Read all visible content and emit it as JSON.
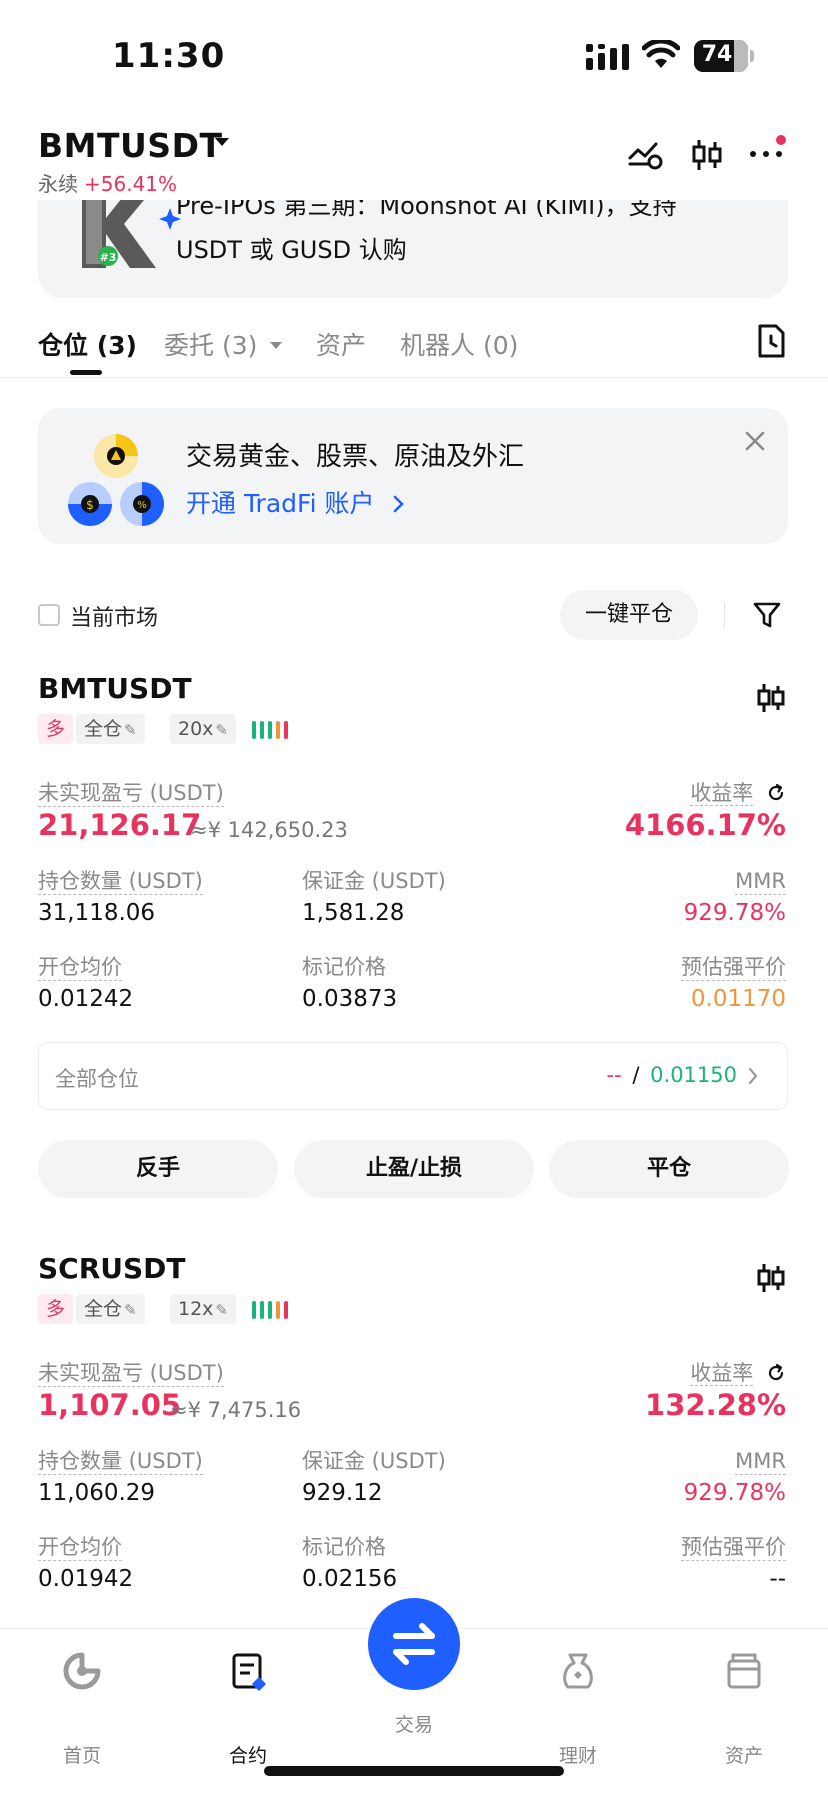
{
  "status_bar": {
    "time": "11:30",
    "battery": "74"
  },
  "header": {
    "symbol": "BMTUSDT",
    "type": "永续",
    "change": "+56.41%"
  },
  "promo": {
    "line1": "Pre-IPOs 第三期：Moonshot AI (KIMI)，支持",
    "line2": "USDT 或 GUSD 认购",
    "badge": "#3"
  },
  "tabs": [
    {
      "label": "仓位 (3)"
    },
    {
      "label": "委托 (3)"
    },
    {
      "label": "资产"
    },
    {
      "label": "机器人 (0)"
    }
  ],
  "tradfi": {
    "title": "交易黄金、股票、原油及外汇",
    "link": "开通 TradFi 账户"
  },
  "filter": {
    "current_market": "当前市场",
    "close_all": "一键平仓"
  },
  "labels": {
    "unrealized_pnl": "未实现盈亏 (USDT)",
    "roe": "收益率",
    "size": "持仓数量 (USDT)",
    "margin": "保证金 (USDT)",
    "mmr": "MMR",
    "entry_price": "开仓均价",
    "mark_price": "标记价格",
    "liq_price": "预估强平价",
    "all_positions": "全部仓位",
    "reverse": "反手",
    "tpsl": "止盈/止损",
    "close": "平仓"
  },
  "positions": [
    {
      "symbol": "BMTUSDT",
      "side": "多",
      "margin_mode": "全仓",
      "leverage": "20x",
      "unrealized_pnl": "21,126.17",
      "pnl_cny": "≈¥ 142,650.23",
      "roe": "4166.17%",
      "size": "31,118.06",
      "margin": "1,581.28",
      "mmr": "929.78%",
      "entry_price": "0.01242",
      "mark_price": "0.03873",
      "liq_price": "0.01170",
      "all_pos_tp": "--",
      "all_pos_sep": "/",
      "all_pos_sl": "0.01150"
    },
    {
      "symbol": "SCRUSDT",
      "side": "多",
      "margin_mode": "全仓",
      "leverage": "12x",
      "unrealized_pnl": "1,107.05",
      "pnl_cny": "≈¥ 7,475.16",
      "roe": "132.28%",
      "size": "11,060.29",
      "margin": "929.12",
      "mmr": "929.78%",
      "entry_price": "0.01942",
      "mark_price": "0.02156",
      "liq_price": "--"
    }
  ],
  "bottom_nav": [
    {
      "label": "首页",
      "icon": "home-icon"
    },
    {
      "label": "合约",
      "icon": "contract-icon"
    },
    {
      "label": "交易",
      "icon": "swap-icon"
    },
    {
      "label": "理财",
      "icon": "earn-icon"
    },
    {
      "label": "资产",
      "icon": "wallet-icon"
    }
  ],
  "colors": {
    "accent": "#1f5eff",
    "loss_red": "#e8335f",
    "gain_green": "#1cb37a",
    "liq_orange": "#f0953a"
  }
}
